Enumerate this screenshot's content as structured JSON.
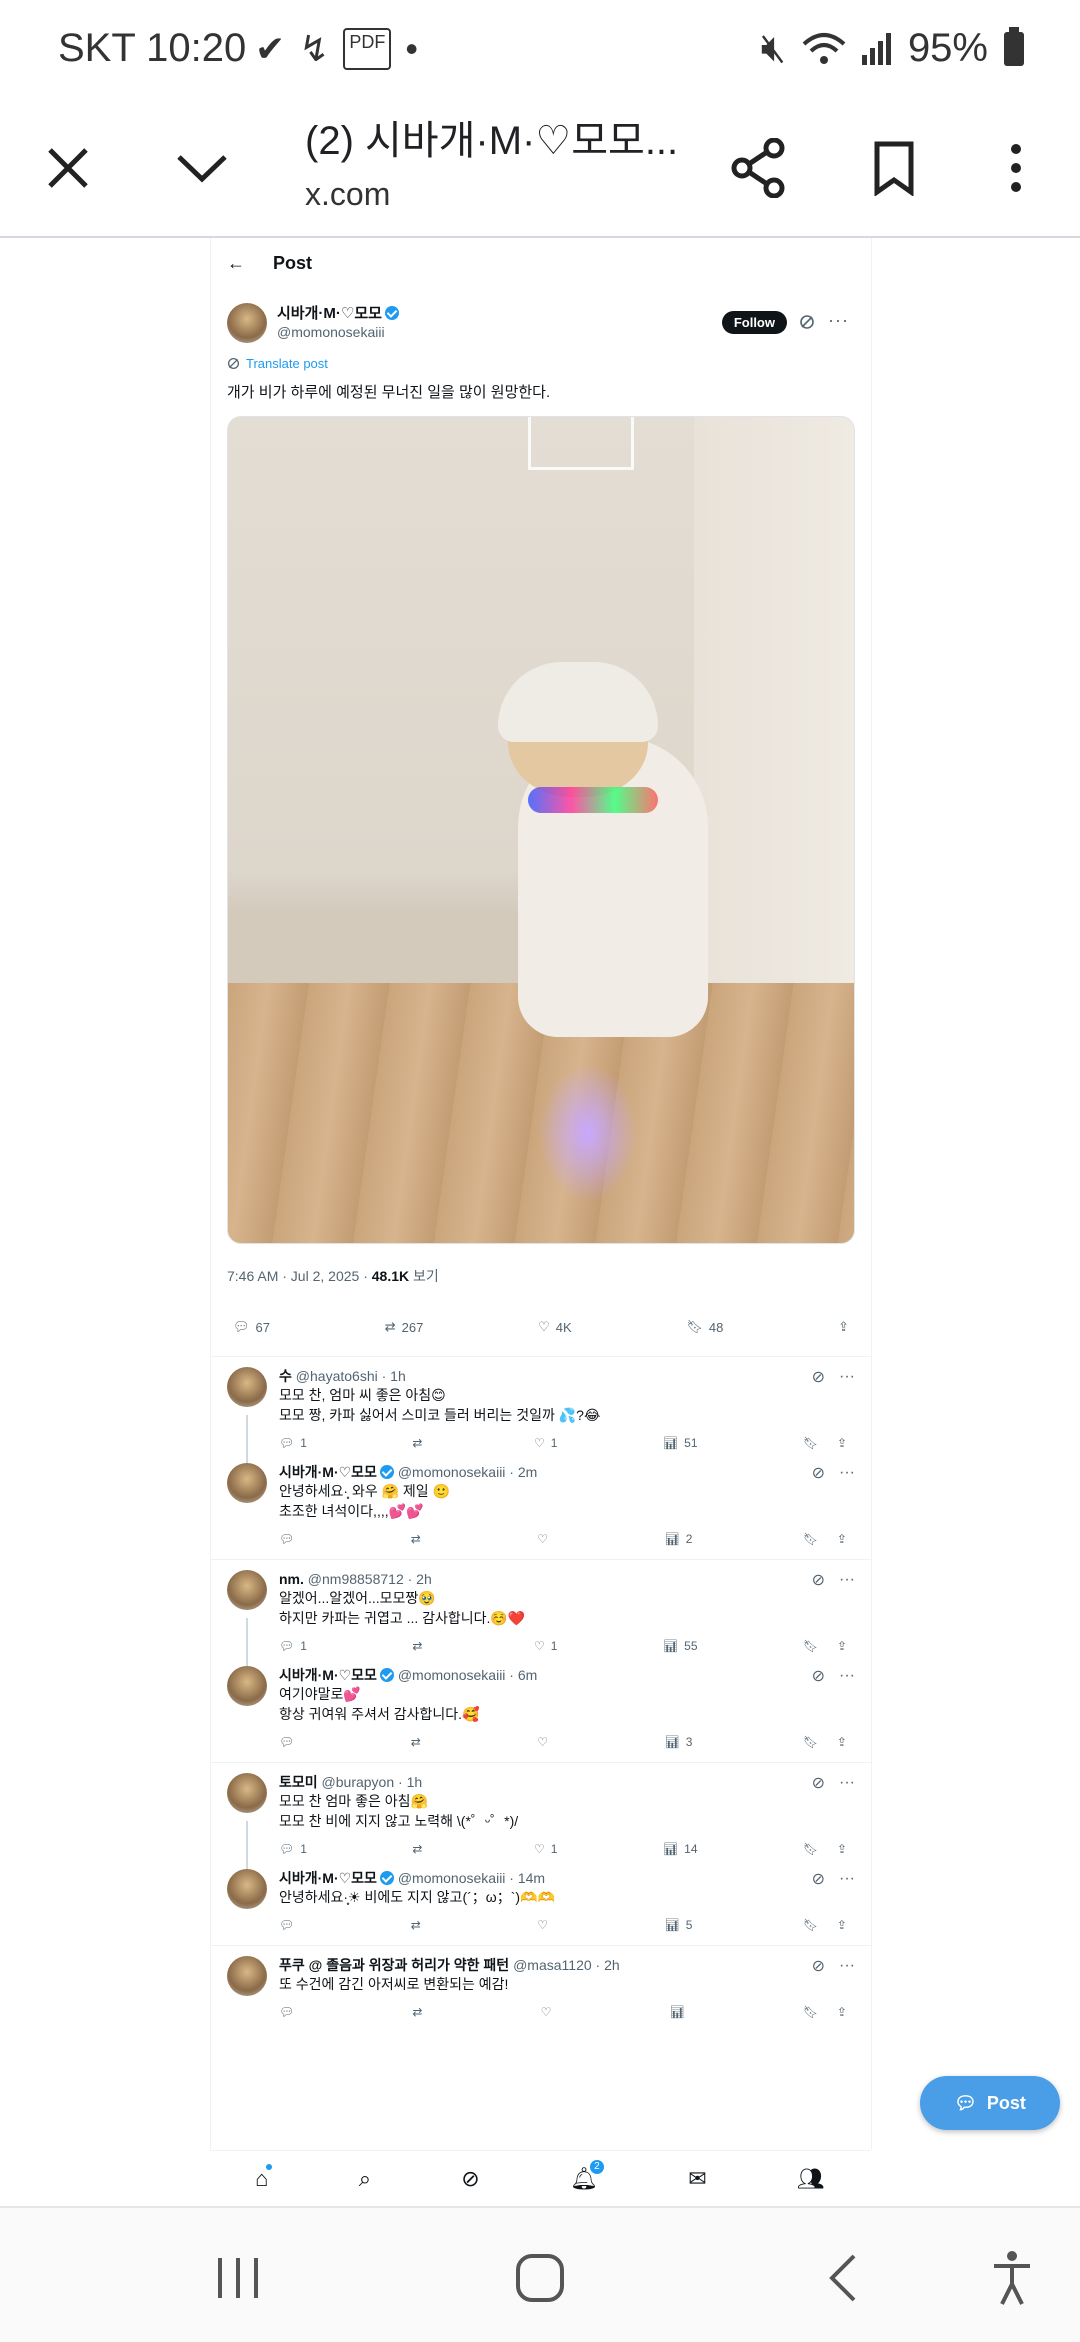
{
  "status_bar": {
    "carrier_time": "SKT 10:20",
    "battery": "95%",
    "left_icons": [
      "check-icon",
      "missed-call-icon",
      "pdf-icon",
      "dot-icon"
    ],
    "right_icons": [
      "mute-icon",
      "wifi-icon",
      "signal-icon",
      "battery-icon"
    ]
  },
  "toolbar": {
    "title": "(2) 시바개·M·♡모모...",
    "url": "x.com"
  },
  "page": {
    "header_title": "Post",
    "post": {
      "name": "시바개·M·♡모모",
      "handle": "@momonosekaiii",
      "follow_label": "Follow",
      "translate_label": "Translate post",
      "text": "개가 비가 하루에 예정된 무너진 일을 많이 원망한다.",
      "timestamp": "7:46 AM · Jul 2, 2025 · ",
      "views": "48.1K",
      "views_label": " 보기",
      "replies": "67",
      "reposts": "267",
      "likes": "4K",
      "bookmarks": "48"
    },
    "replies": [
      {
        "name": "수",
        "handle": "@hayato6shi · 1h",
        "verified": false,
        "lines": [
          "모모 찬, 엄마 씨 좋은 아침😊",
          "모모 짱, 카파 싫어서 스미코 들러 버리는 것일까 💦?😂"
        ],
        "reply_count": "1",
        "repost_count": "",
        "like_count": "1",
        "view_count": "51"
      },
      {
        "name": "시바개·M·♡모모",
        "handle": "@momonosekaiii · 2m",
        "verified": true,
        "lines": [
          "안녕하세요·̩͙ 와우 🤗 제일 🙂",
          "초조한 녀석이다,,,,💕💕"
        ],
        "reply_count": "",
        "repost_count": "",
        "like_count": "",
        "view_count": "2"
      },
      {
        "name": "nm.",
        "handle": "@nm98858712 · 2h",
        "verified": false,
        "lines": [
          "알겠어...알겠어...모모짱🥹",
          "하지만 카파는 귀엽고 ... 감사합니다.☺️❤️"
        ],
        "reply_count": "1",
        "repost_count": "",
        "like_count": "1",
        "view_count": "55"
      },
      {
        "name": "시바개·M·♡모모",
        "handle": "@momonosekaiii · 6m",
        "verified": true,
        "lines": [
          "여기야말로💕",
          "항상 귀여워 주셔서 감사합니다.🥰"
        ],
        "reply_count": "",
        "repost_count": "",
        "like_count": "",
        "view_count": "3"
      },
      {
        "name": "토모미",
        "handle": "@burapyon · 1h",
        "verified": false,
        "lines": [
          "모모 찬 엄마 좋은 아침🤗",
          "모모 찬 비에 지지 않고 노력해 \\(*゜ᵕ゜*)/"
        ],
        "reply_count": "1",
        "repost_count": "",
        "like_count": "1",
        "view_count": "14"
      },
      {
        "name": "시바개·M·♡모모",
        "handle": "@momonosekaiii · 14m",
        "verified": true,
        "lines": [
          "안녕하세요·̩͙☀ 비에도 지지 않고(´；ω；`)🫶🫶"
        ],
        "reply_count": "",
        "repost_count": "",
        "like_count": "",
        "view_count": "5"
      },
      {
        "name": "푸쿠 @ 졸음과 위장과 허리가 약한 패턴",
        "handle": "@masa1120 · 2h",
        "verified": false,
        "lines": [
          "또 수건에 감긴 아저씨로 변환되는 예감!"
        ],
        "reply_count": "",
        "repost_count": "",
        "like_count": "",
        "view_count": ""
      }
    ],
    "fab_label": "Post",
    "notification_badge": "2"
  }
}
